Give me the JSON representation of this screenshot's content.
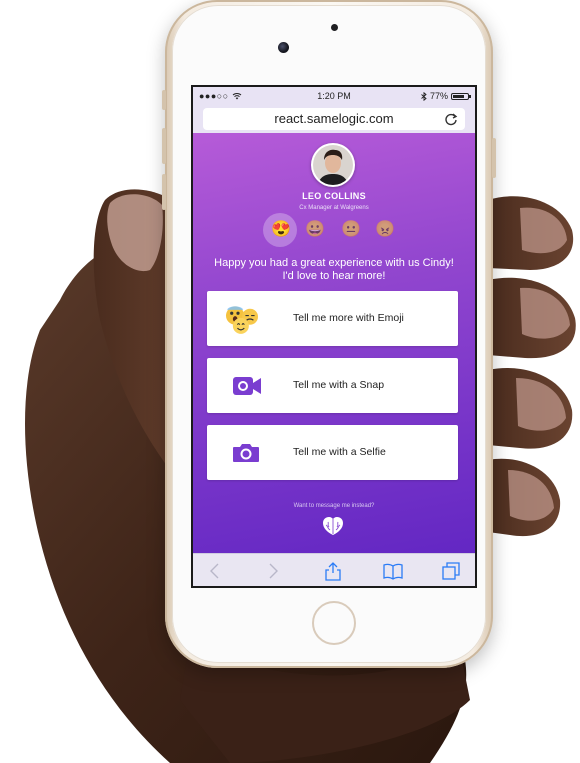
{
  "status_bar": {
    "signal": "●●●○○",
    "time": "1:20 PM",
    "battery": "77%"
  },
  "url_bar": {
    "url": "react.samelogic.com"
  },
  "profile": {
    "name": "LEO COLLINS",
    "role": "Cx Manager at Walgreens"
  },
  "rating": {
    "options": [
      "😍",
      "😀",
      "😐",
      "😠"
    ],
    "selected_index": 0
  },
  "message": {
    "line1": "Happy you had a great experience with us Cindy!",
    "line2": "I'd love to hear more!"
  },
  "options": [
    {
      "label": "Tell me more with Emoji",
      "icon": "emoji-cluster-icon"
    },
    {
      "label": "Tell me with a Snap",
      "icon": "video-camera-icon"
    },
    {
      "label": "Tell me with a Selfie",
      "icon": "photo-camera-icon"
    }
  ],
  "footer": {
    "hint": "Want to message me instead?"
  },
  "colors": {
    "accent": "#7a3dd0",
    "gradient_top": "#b65bd8",
    "gradient_bottom": "#6327c3"
  }
}
